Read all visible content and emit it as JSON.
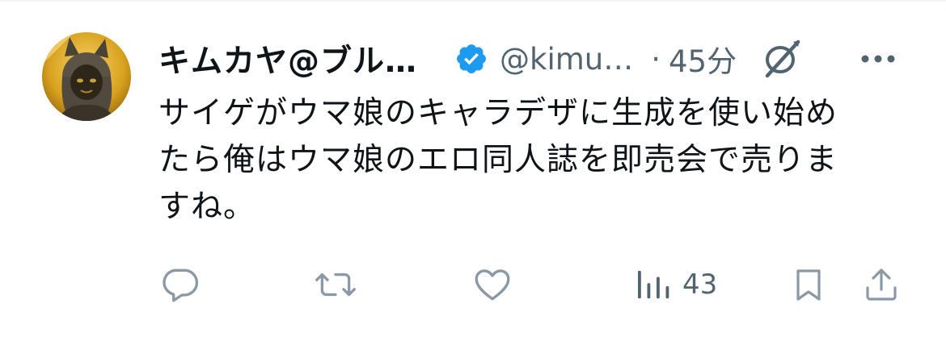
{
  "tweet": {
    "author": {
      "display_name": "キムカヤ@ブル…",
      "handle": "@kimu…",
      "verified": true,
      "avatar_icon": "user-avatar"
    },
    "separator": "·",
    "time": "45分",
    "header_icons": [
      "verified-badge-icon",
      "grok-icon",
      "more-icon"
    ],
    "text_lines": [
      "サイゲがウマ娘のキャラデザに生成を使い始め",
      "たら俺はウマ娘のエロ同人誌を即売会で売りま",
      "すね。"
    ],
    "actions": {
      "reply_icon": "reply-icon",
      "repost_icon": "repost-icon",
      "like_icon": "heart-icon",
      "views_icon": "analytics-icon",
      "views_count": "43",
      "bookmark_icon": "bookmark-icon",
      "share_icon": "share-icon"
    },
    "colors": {
      "text": "#0f1419",
      "secondary": "#536471",
      "verified": "#1d9bf0",
      "icon": "#8b98a5"
    }
  }
}
